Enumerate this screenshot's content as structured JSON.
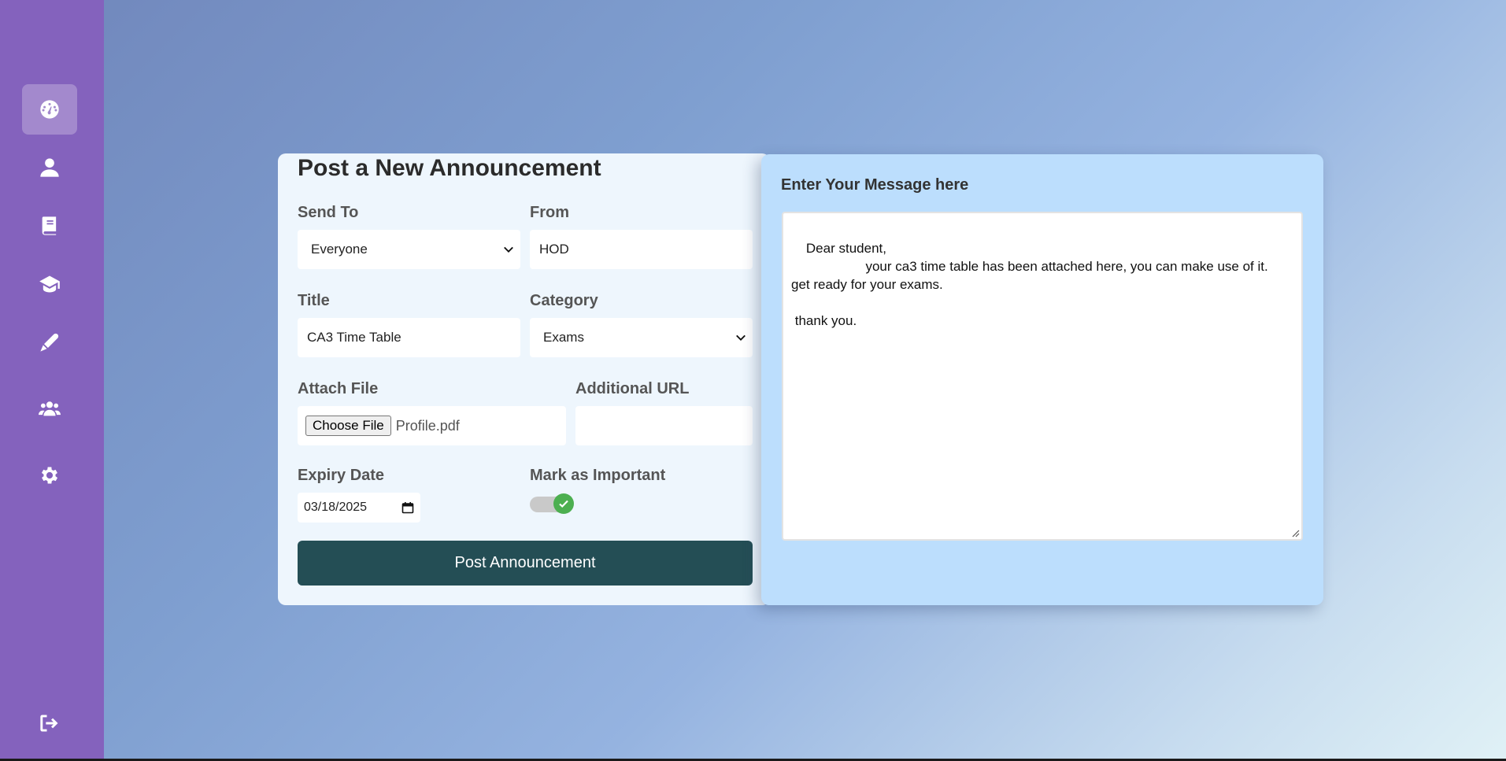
{
  "sidebar": {
    "items": [
      {
        "icon": "dashboard-icon",
        "active": true
      },
      {
        "icon": "user-icon",
        "active": false
      },
      {
        "icon": "book-icon",
        "active": false
      },
      {
        "icon": "graduation-cap-icon",
        "active": false
      },
      {
        "icon": "pen-icon",
        "active": false
      },
      {
        "icon": "users-icon",
        "active": false
      },
      {
        "icon": "gear-icon",
        "active": false
      }
    ],
    "logout_icon": "logout-icon"
  },
  "form": {
    "title": "Post a New Announcement",
    "send_to": {
      "label": "Send To",
      "value": "Everyone"
    },
    "from": {
      "label": "From",
      "value": "HOD"
    },
    "title_field": {
      "label": "Title",
      "value": "CA3 Time Table"
    },
    "category": {
      "label": "Category",
      "value": "Exams"
    },
    "attach": {
      "label": "Attach File",
      "button": "Choose File",
      "file_name": "Profile.pdf"
    },
    "additional_url": {
      "label": "Additional URL",
      "value": ""
    },
    "expiry": {
      "label": "Expiry Date",
      "value": "03/18/2025"
    },
    "important": {
      "label": "Mark as Important",
      "checked": true
    },
    "submit": "Post Announcement"
  },
  "message": {
    "heading": "Enter Your Message here",
    "value": "Dear student,\n                    your ca3 time table has been attached here, you can make use of it.\nget ready for your exams.\n\n thank you."
  },
  "colors": {
    "sidebar": "#8462bd",
    "button": "#244e55",
    "toggle_on": "#4caf50",
    "message_panel": "#bcdefd"
  }
}
